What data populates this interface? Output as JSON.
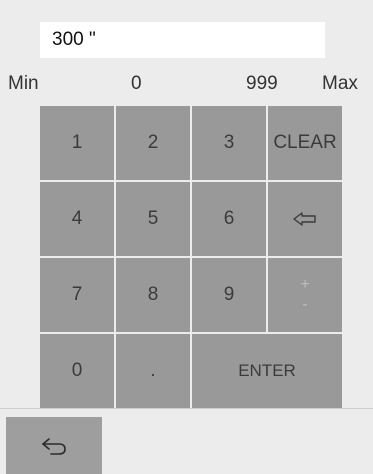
{
  "display": {
    "value": "300 \""
  },
  "range": {
    "min_label": "Min",
    "min_value": "0",
    "max_value": "999",
    "max_label": "Max"
  },
  "keys": {
    "k1": "1",
    "k2": "2",
    "k3": "3",
    "clear": "CLEAR",
    "k4": "4",
    "k5": "5",
    "k6": "6",
    "k7": "7",
    "k8": "8",
    "k9": "9",
    "plus": "+",
    "minus": "-",
    "k0": "0",
    "dot": ".",
    "enter": "ENTER"
  },
  "icons": {
    "backspace": "backspace-arrow-icon",
    "back": "return-arrow-icon"
  },
  "colors": {
    "key_bg": "#999999",
    "background": "#ececec",
    "display_bg": "#ffffff"
  }
}
